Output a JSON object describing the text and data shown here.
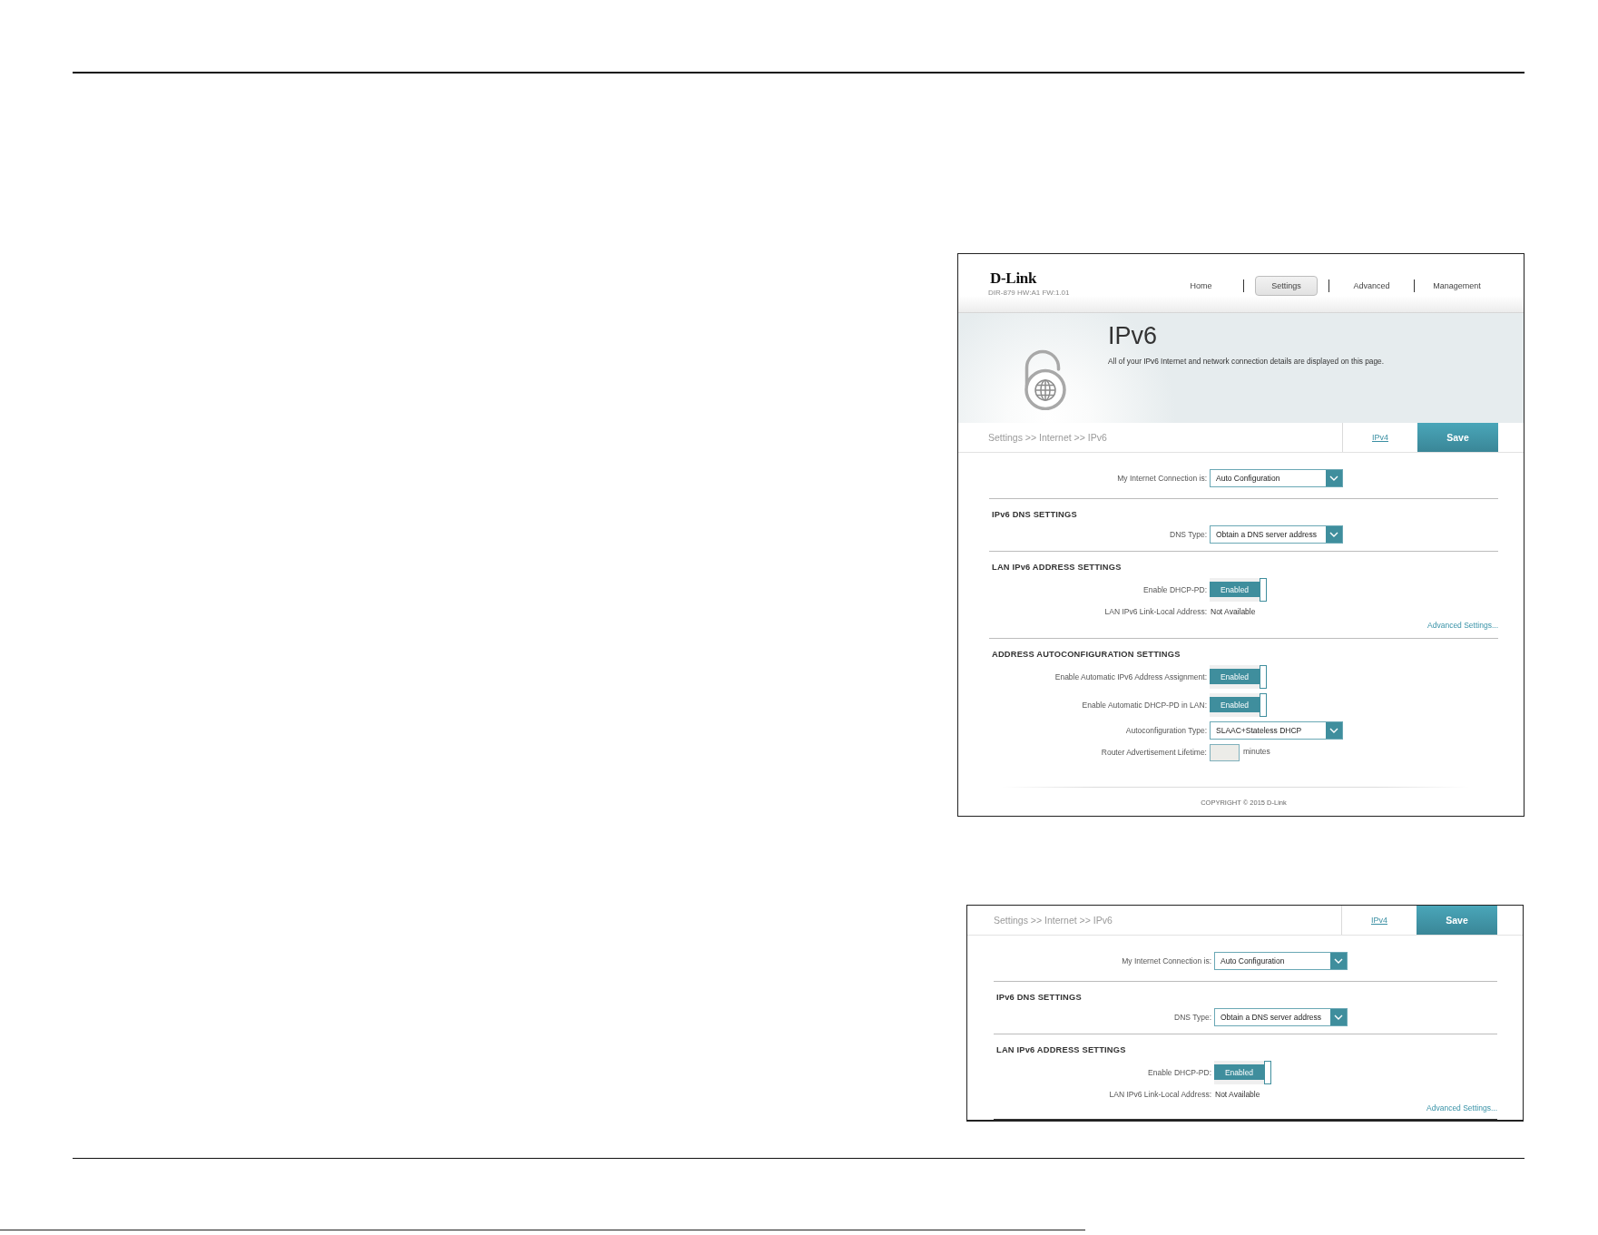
{
  "screenshots": [
    {
      "header": {
        "logo": "D-Link",
        "model": "DIR-879 HW:A1 FW:1.01",
        "nav": [
          {
            "label": "Home",
            "selected": false
          },
          {
            "label": "Settings",
            "selected": true
          },
          {
            "label": "Advanced",
            "selected": false
          },
          {
            "label": "Management",
            "selected": false
          }
        ]
      },
      "hero": {
        "title": "IPv6",
        "description": "All of your IPv6 Internet and network connection details are displayed on this page."
      },
      "breadcrumb": "Settings >> Internet >> IPv6",
      "ipv4_link": "IPv4",
      "save_button": "Save",
      "sections": [
        {
          "rows": [
            {
              "kind": "select",
              "label": "My Internet Connection is:",
              "value": "Auto Configuration"
            }
          ]
        },
        {
          "heading": "IPv6 DNS SETTINGS",
          "rows": [
            {
              "kind": "select",
              "label": "DNS Type:",
              "value": "Obtain a DNS server address"
            }
          ]
        },
        {
          "heading": "LAN IPv6 ADDRESS SETTINGS",
          "rows": [
            {
              "kind": "toggle",
              "label": "Enable DHCP-PD:",
              "value": "Enabled",
              "on": true
            },
            {
              "kind": "text",
              "label": "LAN IPv6 Link-Local Address:",
              "value": "Not Available"
            }
          ],
          "link": "Advanced Settings..."
        },
        {
          "heading": "ADDRESS AUTOCONFIGURATION SETTINGS",
          "rows": [
            {
              "kind": "toggle",
              "label": "Enable Automatic IPv6 Address Assignment:",
              "value": "Enabled",
              "on": true
            },
            {
              "kind": "toggle",
              "label": "Enable Automatic DHCP-PD in LAN:",
              "value": "Enabled",
              "on": true
            },
            {
              "kind": "select",
              "label": "Autoconfiguration Type:",
              "value": "SLAAC+Stateless DHCP"
            },
            {
              "kind": "input",
              "label": "Router Advertisement Lifetime:",
              "unit": "minutes"
            }
          ]
        }
      ],
      "footer": "COPYRIGHT © 2015 D-Link"
    },
    {
      "breadcrumb": "Settings >> Internet >> IPv6",
      "ipv4_link": "IPv4",
      "save_button": "Save",
      "sections": [
        {
          "rows": [
            {
              "kind": "select",
              "label": "My Internet Connection is:",
              "value": "Auto Configuration"
            }
          ]
        },
        {
          "heading": "IPv6 DNS SETTINGS",
          "rows": [
            {
              "kind": "select",
              "label": "DNS Type:",
              "value": "Obtain a DNS server address"
            }
          ]
        },
        {
          "heading": "LAN IPv6 ADDRESS SETTINGS",
          "rows": [
            {
              "kind": "toggle",
              "label": "Enable DHCP-PD:",
              "value": "Enabled",
              "on": true
            },
            {
              "kind": "text",
              "label": "LAN IPv6 Link-Local Address:",
              "value": "Not Available"
            }
          ],
          "link": "Advanced Settings..."
        }
      ]
    }
  ]
}
